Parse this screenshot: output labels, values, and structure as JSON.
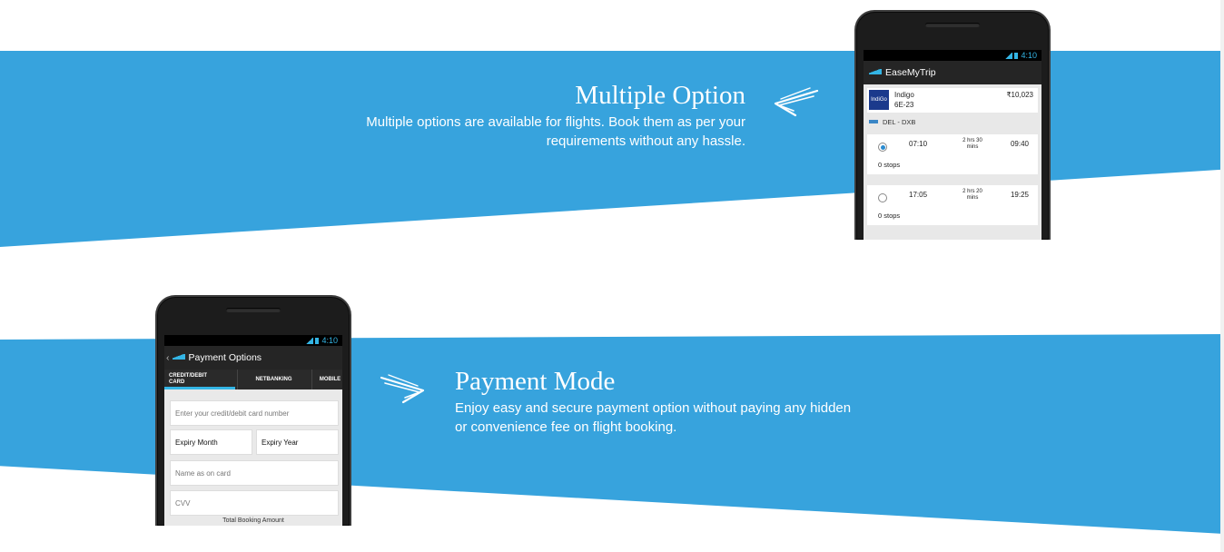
{
  "features": {
    "multiple": {
      "title": "Multiple Option",
      "line1": "Multiple options are available for flights. Book them as per your",
      "line2": "requirements without any hassle."
    },
    "payment": {
      "title": "Payment Mode",
      "line1": "Enjoy easy and secure payment option without paying any hidden",
      "line2": "or convenience fee on flight booking."
    }
  },
  "status_time": "4:10",
  "flight_app": {
    "app_name": "EaseMyTrip",
    "airline": "Indigo",
    "airline_logo_text": "IndiGo",
    "flight_code": "6E-23",
    "price": "₹10,023",
    "route": "DEL - DXB",
    "options": [
      {
        "dep": "07:10",
        "duration_1": "2 hrs 30",
        "duration_2": "mins",
        "arr": "09:40",
        "stops": "0 stops",
        "selected": true
      },
      {
        "dep": "17:05",
        "duration_1": "2 hrs 20",
        "duration_2": "mins",
        "arr": "19:25",
        "stops": "0 stops",
        "selected": false
      }
    ]
  },
  "payment_app": {
    "title": "Payment Options",
    "tabs": [
      {
        "line1": "CREDIT/DEBIT",
        "line2": "CARD"
      },
      {
        "label": "NETBANKING"
      },
      {
        "label": "MOBILE"
      }
    ],
    "card_number_placeholder": "Enter your credit/debit card number",
    "expiry_month": "Expiry Month",
    "expiry_year": "Expiry Year",
    "name_placeholder": "Name as on card",
    "cvv_placeholder": "CVV",
    "total_label": "Total Booking Amount"
  },
  "colors": {
    "band": "#37a3dd",
    "accent": "#33b5e5"
  }
}
